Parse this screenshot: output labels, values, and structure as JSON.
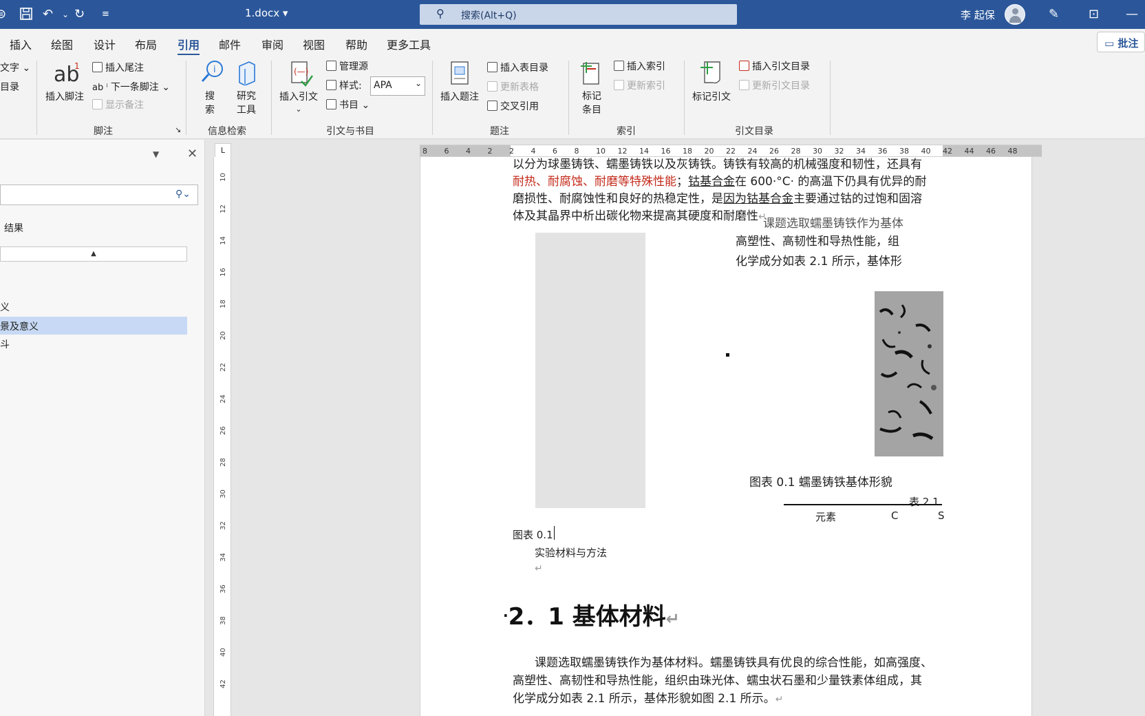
{
  "titlebar": {
    "doc_title": "1.docx ▾",
    "search_placeholder": "搜索(Alt+Q)",
    "user_name": "李 起保",
    "save_icon": "save-icon",
    "undo_icon": "undo-icon",
    "redo_icon": "redo-icon"
  },
  "tabs": [
    "插入",
    "绘图",
    "设计",
    "布局",
    "引用",
    "邮件",
    "审阅",
    "视图",
    "帮助",
    "更多工具"
  ],
  "active_tab": "引用",
  "comment_button": "批注",
  "ribbon": {
    "partial_left": {
      "a": "文字 ⌄",
      "b": "目录"
    },
    "footnote": {
      "insert_footnote": "插入脚注",
      "insert_endnote": "插入尾注",
      "next_footnote": "下一条脚注",
      "show_notes": "显示备注",
      "group_label": "脚注"
    },
    "research": {
      "search": "搜\n索",
      "search_a": "搜",
      "search_b": "索",
      "research_tool_a": "研究",
      "research_tool_b": "工具",
      "group_label": "信息检索"
    },
    "citations": {
      "insert_citation": "插入引文",
      "manage_sources": "管理源",
      "style_label": "样式:",
      "style_value": "APA",
      "bibliography": "书目",
      "group_label": "引文与书目"
    },
    "captions": {
      "insert_caption": "插入题注",
      "insert_table_of_figures": "插入表目录",
      "update_table": "更新表格",
      "cross_reference": "交叉引用",
      "group_label": "题注"
    },
    "index": {
      "mark_entry_a": "标记",
      "mark_entry_b": "条目",
      "insert_index": "插入索引",
      "update_index": "更新索引",
      "group_label": "索引"
    },
    "toa": {
      "mark_citation": "标记引文",
      "insert_toa": "插入引文目录",
      "update_toa": "更新引文目录",
      "group_label": "引文目录"
    }
  },
  "navpane": {
    "results_label": "结果",
    "items": [
      "义",
      "景及意义",
      "斗"
    ]
  },
  "ruler": {
    "h_numbers": [
      "8",
      "6",
      "4",
      "2",
      "2",
      "4",
      "6",
      "8",
      "10",
      "12",
      "14",
      "16",
      "18",
      "20",
      "22",
      "24",
      "26",
      "28",
      "30",
      "32",
      "34",
      "36",
      "38",
      "40",
      "42",
      "44",
      "46",
      "48"
    ],
    "v_numbers": [
      "10",
      "12",
      "14",
      "16",
      "18",
      "20",
      "22",
      "24",
      "26",
      "28",
      "30",
      "32",
      "34",
      "36",
      "38",
      "40",
      "42"
    ]
  },
  "document": {
    "line1": "以分为球墨铸铁、蠕墨铸铁以及灰铸铁。铸铁有较高的机械强度和韧性，还具有",
    "line2_red": "耐热、耐腐蚀、耐磨等特殊性能",
    "line2_sep": "；",
    "line2_ul": "钴基合金",
    "line2_rest": "在 600·°C· 的高温下仍具有优异的耐",
    "line3_a": "磨损性、耐腐蚀性和良好的热稳定性，是",
    "line3_ul": "因为钴基合金",
    "line3_b": "主要通过钴的过饱和固溶",
    "line4": "体及其晶界中析出碳化物来提高其硬度和耐磨性",
    "overlap_top": "课题选取蠕墨铸铁作为基体",
    "overlap_1": "高塑性、高韧性和导热性能，组",
    "overlap_2": "化学成分如表 2.1 所示，基体形",
    "fig_caption": "图表 0.1 蠕墨铸铁基体形貌",
    "table_title": "表 2.1",
    "table_col1": "元素",
    "table_col2": "C",
    "table_col3": "S",
    "caption_left": "图表 0.1",
    "exp_label": "实验材料与方法",
    "heading": "2．1 基体材料",
    "body1": "课题选取蠕墨铸铁作为基体材料。蠕墨铸铁具有优良的综合性能，如高强度、",
    "body2": "高塑性、高韧性和导热性能，组织由珠光体、蠕虫状石墨和少量铁素体组成，其",
    "body3": "化学成分如表 2.1 所示，基体形貌如图 2.1 所示。"
  },
  "colors": {
    "brand": "#2b579a",
    "red_text": "#c42b1c"
  }
}
